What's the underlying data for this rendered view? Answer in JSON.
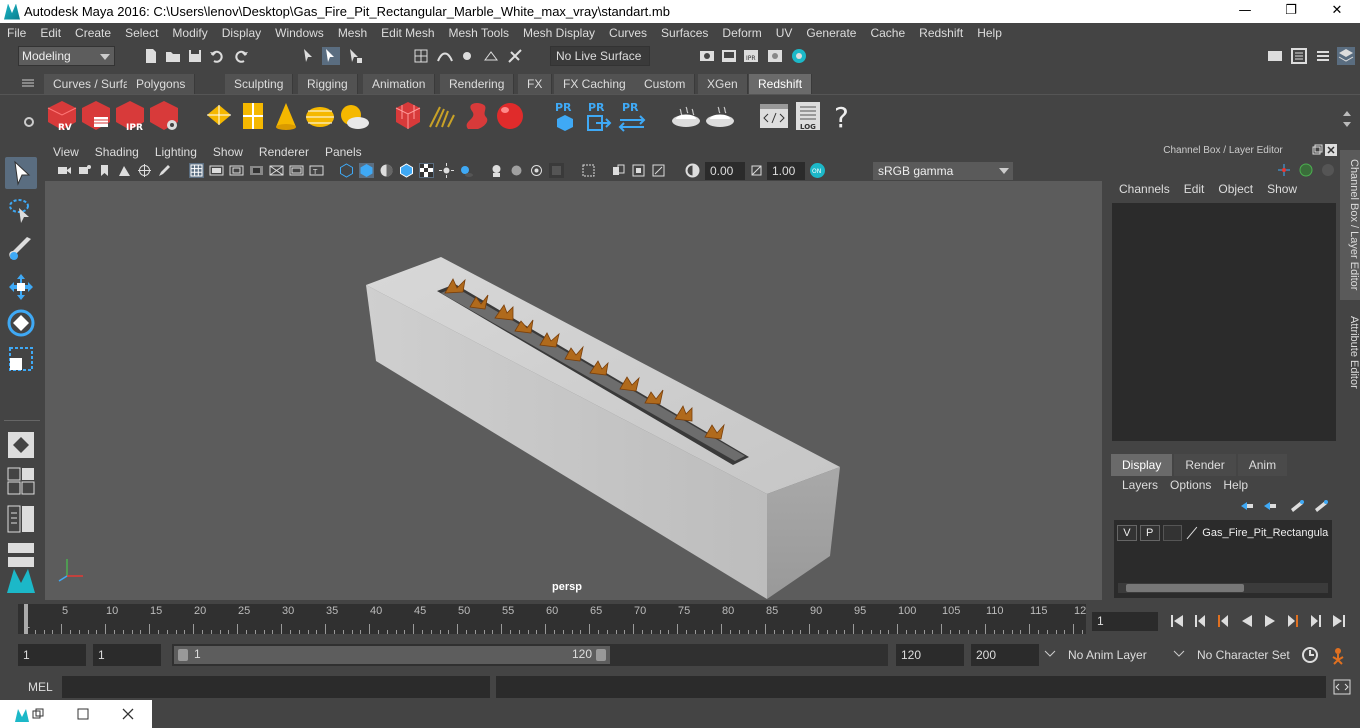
{
  "window": {
    "title": "Autodesk Maya 2016: C:\\Users\\lenov\\Desktop\\Gas_Fire_Pit_Rectangular_Marble_White_max_vray\\standart.mb",
    "minimize": "—",
    "maximize": "❐",
    "close": "✕"
  },
  "menubar": [
    "File",
    "Edit",
    "Create",
    "Select",
    "Modify",
    "Display",
    "Windows",
    "Mesh",
    "Edit Mesh",
    "Mesh Tools",
    "Mesh Display",
    "Curves",
    "Surfaces",
    "Deform",
    "UV",
    "Generate",
    "Cache",
    "Redshift",
    "Help"
  ],
  "statusline": {
    "mode": "Modeling",
    "live_surface": "No Live Surface"
  },
  "shelf_tabs": [
    "Curves / Surfaces",
    "Polygons",
    "Sculpting",
    "Rigging",
    "Animation",
    "Rendering",
    "FX",
    "FX Caching",
    "Custom",
    "XGen",
    "Redshift"
  ],
  "active_shelf_tab": "Redshift",
  "shelf_icons": {
    "rv": "RV",
    "ipr": "IPR",
    "pr": "PR",
    "log": "LOG",
    "help": "?"
  },
  "panel_menu": [
    "View",
    "Shading",
    "Lighting",
    "Show",
    "Renderer",
    "Panels"
  ],
  "panel_tools": {
    "exposure": "0.00",
    "gamma": "1.00",
    "color_space": "sRGB gamma"
  },
  "viewport": {
    "camera": "persp"
  },
  "right_panel": {
    "title": "Channel Box / Layer Editor",
    "menu": [
      "Channels",
      "Edit",
      "Object",
      "Show"
    ],
    "tabs": [
      "Display",
      "Render",
      "Anim"
    ],
    "active_tab": "Display",
    "layer_menu": [
      "Layers",
      "Options",
      "Help"
    ],
    "layer": {
      "visible": "V",
      "playback": "P",
      "name": "Gas_Fire_Pit_Rectangula"
    }
  },
  "side_tabs": [
    "Channel Box / Layer Editor",
    "Attribute Editor"
  ],
  "timeline": {
    "ticks": [
      "1",
      "5",
      "10",
      "15",
      "20",
      "25",
      "30",
      "35",
      "40",
      "45",
      "50",
      "55",
      "60",
      "65",
      "70",
      "75",
      "80",
      "85",
      "90",
      "95",
      "100",
      "105",
      "110",
      "115",
      "12"
    ],
    "current_frame": "1"
  },
  "range": {
    "start": "1",
    "playback_start": "1",
    "range_start_label": "1",
    "range_end_label": "120",
    "playback_end": "120",
    "end": "200",
    "anim_layer": "No Anim Layer",
    "character_set": "No Character Set"
  },
  "command_line": {
    "label": "MEL"
  },
  "colors": {
    "accent": "#1cb8c8",
    "panel": "#444444",
    "field": "#2b2b2b",
    "viewport": "#5c5c5c"
  }
}
